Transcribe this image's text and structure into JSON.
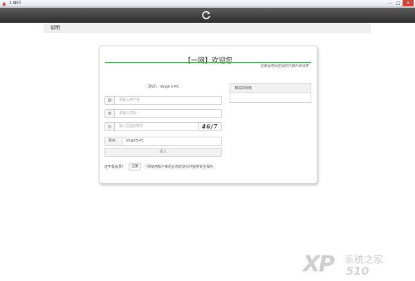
{
  "window": {
    "title": "1-NET",
    "app_icon": "triangle-logo-icon",
    "controls": {
      "minimize": "—",
      "maximize": "□",
      "close": "✕"
    }
  },
  "toolbar": {
    "refresh_icon": "refresh-icon"
  },
  "menu": {
    "items": [
      {
        "label": "说明"
      }
    ]
  },
  "login": {
    "title": "【一网】欢迎您",
    "subtitle": "任意适用地连接的只额外和消费",
    "node_text": "测点：h5@h5-PC",
    "username_icon": "@",
    "username_placeholder": "请输入用户名",
    "password_icon": "⚙",
    "password_placeholder": "请输入密码",
    "captcha_icon": "◎",
    "captcha_placeholder": "输入右图的数字",
    "captcha_value": "46/7",
    "node_label": "测点：",
    "node_value": "h5@h5-PC",
    "join_label": "加入",
    "not_member": "还不是会员？",
    "register_label": "注册",
    "register_desc": "一网使用账户来组合您的测点并提供安全保护。"
  },
  "related": {
    "header": "相关的网络"
  },
  "watermark": {
    "xp": "XP",
    "cn": "系统之家",
    "num": "510"
  }
}
